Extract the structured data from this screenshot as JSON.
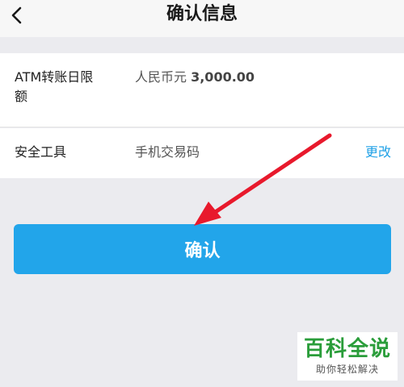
{
  "header": {
    "title": "确认信息",
    "back_icon": "chevron-left-icon"
  },
  "details": {
    "limit_label": "ATM转账日限额",
    "limit_currency": "人民币元 ",
    "limit_amount": "3,000.00",
    "tool_label": "安全工具",
    "tool_value": "手机交易码",
    "change_label": "更改"
  },
  "actions": {
    "confirm_label": "确认"
  },
  "annotation": {
    "arrow_color": "#e8192c"
  },
  "watermark": {
    "main": "百科全说",
    "sub": "助你轻松解决"
  },
  "colors": {
    "accent": "#22a5ea",
    "link": "#1fa0e6",
    "watermark_green": "#2a9d3a"
  }
}
